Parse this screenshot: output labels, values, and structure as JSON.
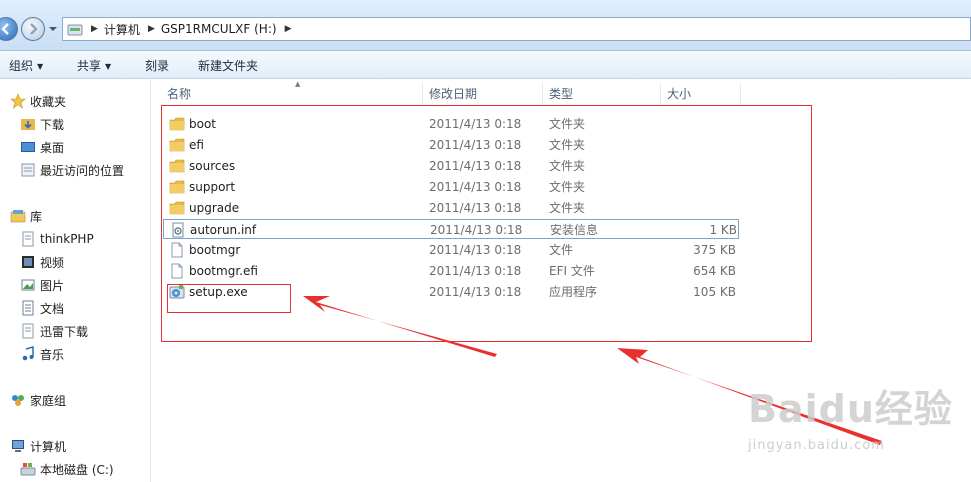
{
  "address": {
    "crumbs": [
      "计算机",
      "GSP1RMCULXF (H:)"
    ]
  },
  "toolbar": {
    "organize": "组织",
    "share": "共享",
    "burn": "刻录",
    "new_folder": "新建文件夹"
  },
  "sidebar": {
    "favorites": {
      "label": "收藏夹",
      "items": [
        "下载",
        "桌面",
        "最近访问的位置"
      ]
    },
    "libraries": {
      "label": "库",
      "items": [
        "thinkPHP",
        "视频",
        "图片",
        "文档",
        "迅雷下载",
        "音乐"
      ]
    },
    "homegroup": {
      "label": "家庭组"
    },
    "computer": {
      "label": "计算机",
      "items": [
        "本地磁盘 (C:)"
      ]
    }
  },
  "columns": {
    "name": "名称",
    "date": "修改日期",
    "type": "类型",
    "size": "大小"
  },
  "files": [
    {
      "name": "boot",
      "date": "2011/4/13 0:18",
      "type": "文件夹",
      "size": "",
      "icon": "folder-icon"
    },
    {
      "name": "efi",
      "date": "2011/4/13 0:18",
      "type": "文件夹",
      "size": "",
      "icon": "folder-icon"
    },
    {
      "name": "sources",
      "date": "2011/4/13 0:18",
      "type": "文件夹",
      "size": "",
      "icon": "folder-icon"
    },
    {
      "name": "support",
      "date": "2011/4/13 0:18",
      "type": "文件夹",
      "size": "",
      "icon": "folder-icon"
    },
    {
      "name": "upgrade",
      "date": "2011/4/13 0:18",
      "type": "文件夹",
      "size": "",
      "icon": "folder-icon"
    },
    {
      "name": "autorun.inf",
      "date": "2011/4/13 0:18",
      "type": "安装信息",
      "size": "1 KB",
      "icon": "settings-file-icon"
    },
    {
      "name": "bootmgr",
      "date": "2011/4/13 0:18",
      "type": "文件",
      "size": "375 KB",
      "icon": "blank-file-icon"
    },
    {
      "name": "bootmgr.efi",
      "date": "2011/4/13 0:18",
      "type": "EFI 文件",
      "size": "654 KB",
      "icon": "blank-file-icon"
    },
    {
      "name": "setup.exe",
      "date": "2011/4/13 0:18",
      "type": "应用程序",
      "size": "105 KB",
      "icon": "setup-exe-icon"
    }
  ],
  "watermark": {
    "brand": "Baidu经验",
    "url": "jingyan.baidu.com"
  },
  "colors": {
    "annotation_red": "#e8312e",
    "folder_yellow": "#e8b84a",
    "selection_border": "#7da2ce"
  }
}
